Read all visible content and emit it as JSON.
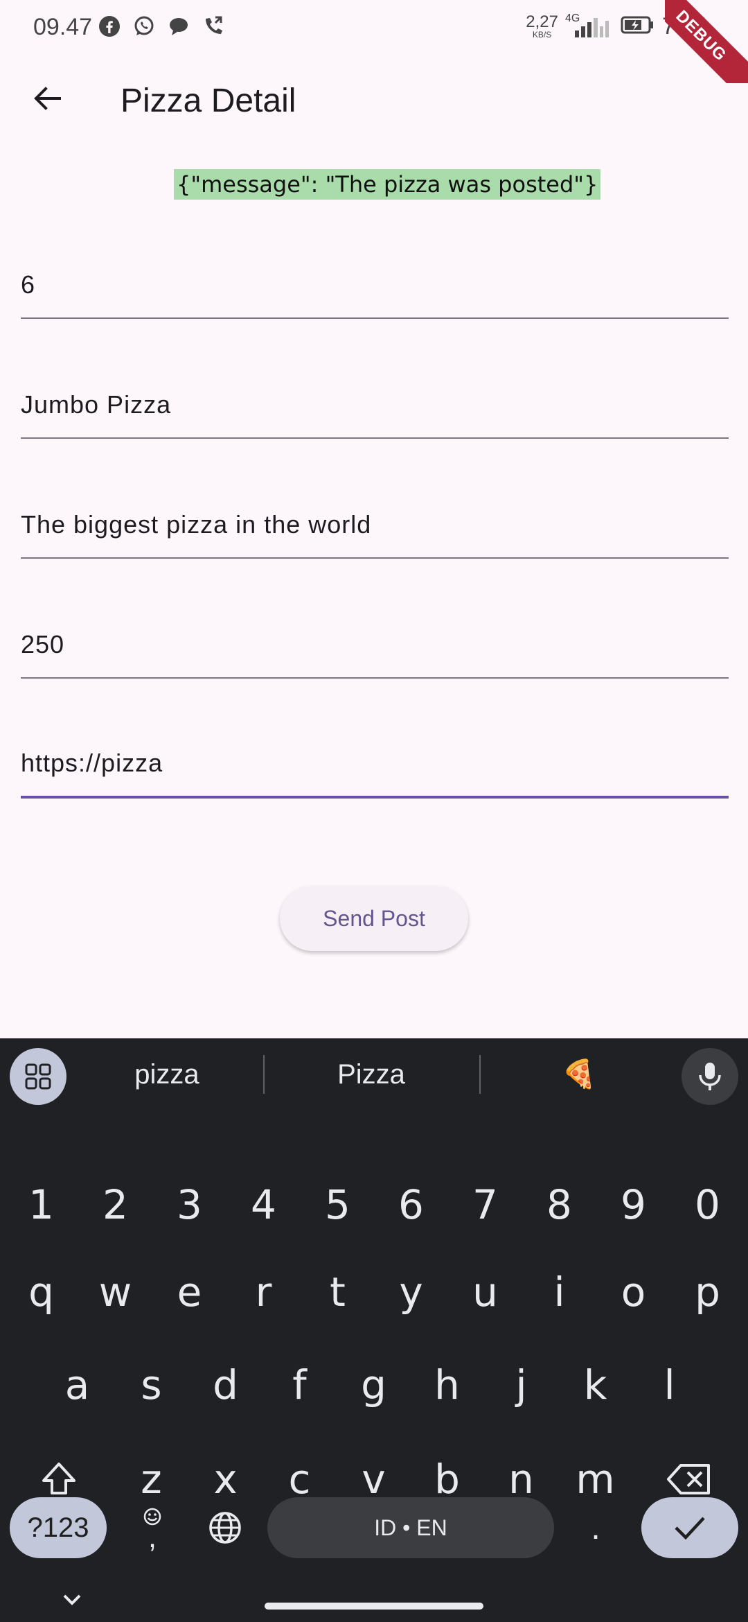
{
  "status_bar": {
    "time": "09.47",
    "net_speed_value": "2,27",
    "net_speed_unit": "KB/S",
    "network_type": "4G",
    "battery_percent": "73%",
    "debug_banner": "DEBUG"
  },
  "app_bar": {
    "title": "Pizza Detail"
  },
  "response_message": "{\"message\": \"The pizza was posted\"}",
  "fields": {
    "id": "6",
    "name": "Jumbo Pizza",
    "description": "The biggest pizza in the world",
    "price": "250",
    "image_url": "https://pizza"
  },
  "send_button_label": "Send Post",
  "keyboard": {
    "suggestions": [
      "pizza",
      "Pizza",
      "🍕"
    ],
    "number_row": [
      "1",
      "2",
      "3",
      "4",
      "5",
      "6",
      "7",
      "8",
      "9",
      "0"
    ],
    "row1": [
      "q",
      "w",
      "e",
      "r",
      "t",
      "y",
      "u",
      "i",
      "o",
      "p"
    ],
    "row2": [
      "a",
      "s",
      "d",
      "f",
      "g",
      "h",
      "j",
      "k",
      "l"
    ],
    "row3": [
      "z",
      "x",
      "c",
      "v",
      "b",
      "n",
      "m"
    ],
    "symbols_label": "?123",
    "comma_label": ",",
    "space_label": "ID • EN",
    "period_label": ".",
    "colors": {
      "background": "#202124",
      "key_text": "#e8eaed",
      "action_key": "#c2c8d9"
    }
  },
  "colors": {
    "page_background": "#fdf7fc",
    "accent": "#6750a4",
    "response_highlight": "#a9dcaa",
    "debug_ribbon": "#b3263a"
  }
}
